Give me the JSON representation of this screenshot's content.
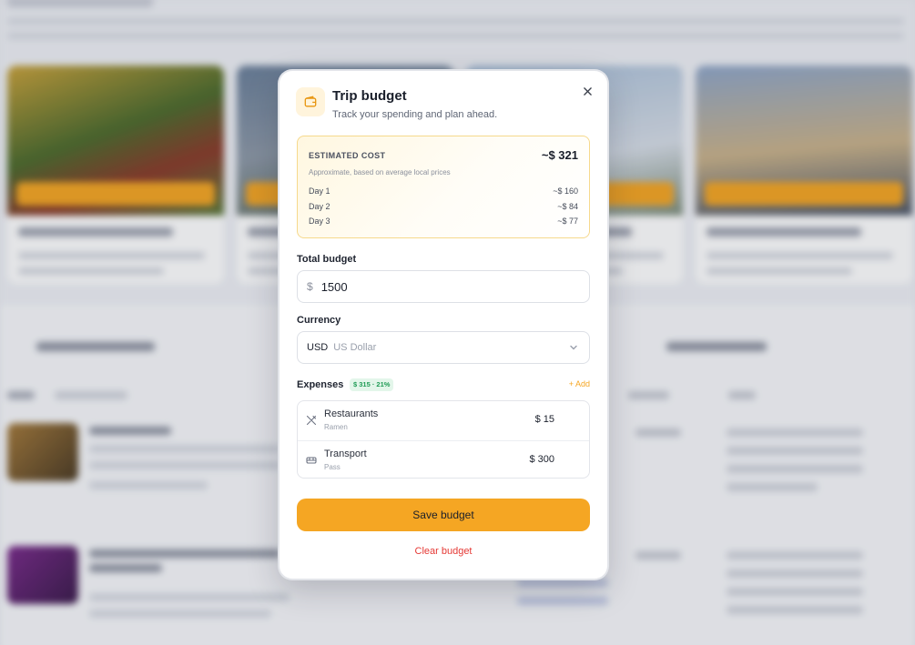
{
  "modal": {
    "title": "Trip budget",
    "subtitle": "Track your spending and plan ahead."
  },
  "estimate": {
    "label": "ESTIMATED COST",
    "total": "~$ 321",
    "note": "Approximate, based on average local prices",
    "days": [
      {
        "label": "Day 1",
        "amount": "~$ 160"
      },
      {
        "label": "Day 2",
        "amount": "~$ 84"
      },
      {
        "label": "Day 3",
        "amount": "~$ 77"
      }
    ]
  },
  "total_budget": {
    "label": "Total budget",
    "prefix": "$",
    "value": "1500"
  },
  "currency": {
    "label": "Currency",
    "code": "USD",
    "name": "US Dollar"
  },
  "expenses": {
    "label": "Expenses",
    "summary": "$ 315 · 21%",
    "add_label": "+ Add",
    "items": [
      {
        "name": "Restaurants",
        "detail": "Ramen",
        "amount": "$ 15",
        "icon": "utensils-icon"
      },
      {
        "name": "Transport",
        "detail": "Pass",
        "amount": "$ 300",
        "icon": "bus-icon"
      }
    ]
  },
  "actions": {
    "save_label": "Save budget",
    "clear_label": "Clear budget"
  },
  "colors": {
    "accent": "#f5a623",
    "danger": "#e53935",
    "success": "#1f9b55"
  }
}
